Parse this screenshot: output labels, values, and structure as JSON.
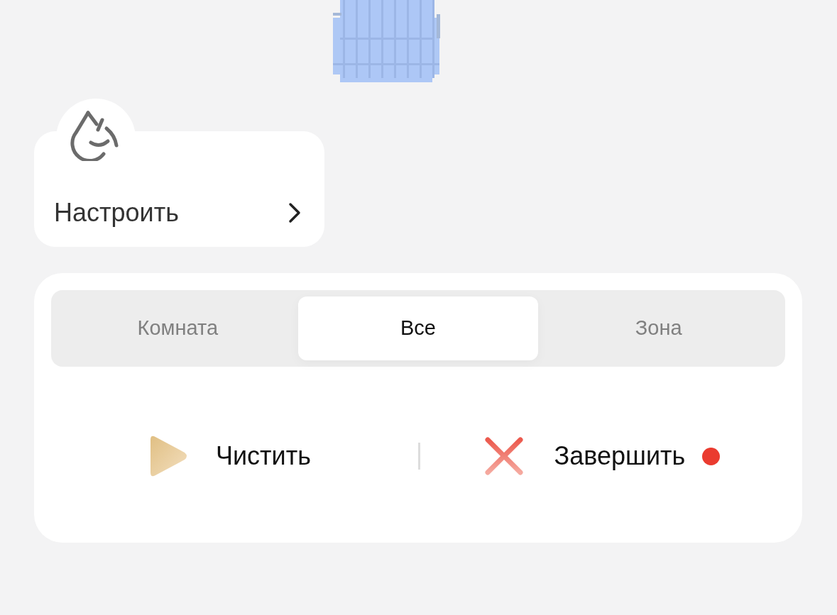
{
  "settings_card": {
    "label": "Настроить"
  },
  "mode_tabs": [
    {
      "label": "Комната",
      "selected": false
    },
    {
      "label": "Все",
      "selected": true
    },
    {
      "label": "Зона",
      "selected": false
    }
  ],
  "actions": [
    {
      "kind": "start",
      "label": "Чистить",
      "alert": false
    },
    {
      "kind": "stop",
      "label": "Завершить",
      "alert": true
    }
  ]
}
